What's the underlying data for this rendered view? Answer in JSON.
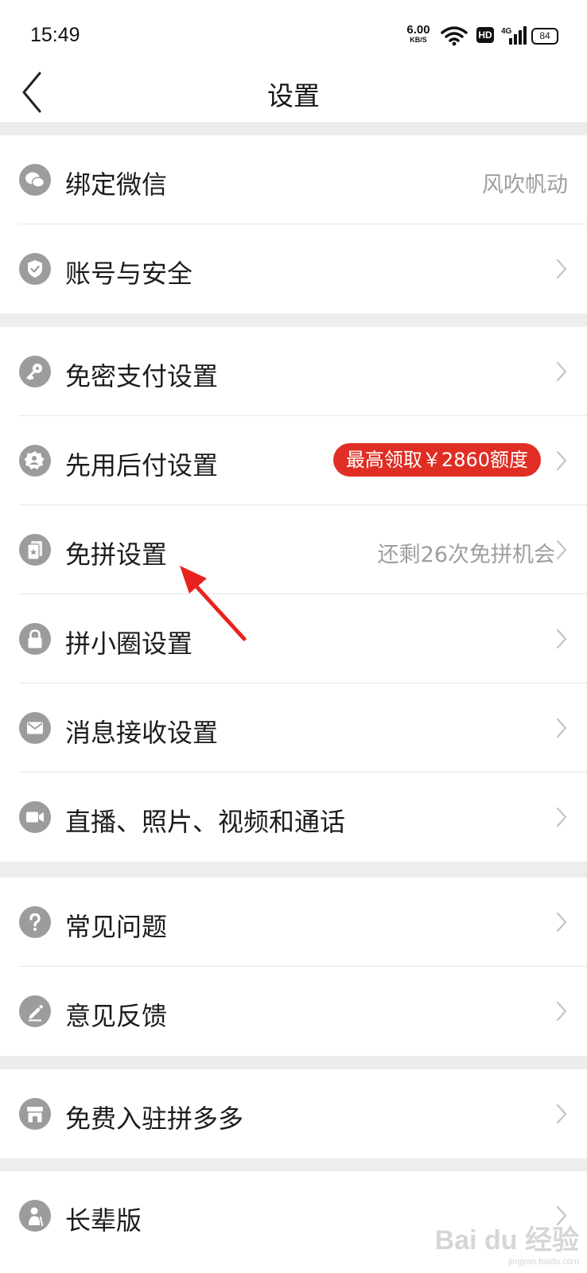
{
  "status_bar": {
    "time": "15:49",
    "net_speed_value": "6.00",
    "net_speed_unit": "KB/S",
    "hd_label": "HD",
    "network_type": "4G",
    "battery": "84"
  },
  "header": {
    "title": "设置"
  },
  "groups": [
    {
      "items": [
        {
          "label": "绑定微信",
          "value": "风吹帆动",
          "icon": "wechat-icon"
        },
        {
          "label": "账号与安全",
          "icon": "shield-icon"
        }
      ]
    },
    {
      "items": [
        {
          "label": "免密支付设置",
          "icon": "key-icon"
        },
        {
          "label": "先用后付设置",
          "badge": "最高领取￥2860额度",
          "icon": "badge-icon"
        },
        {
          "label": "免拼设置",
          "value": "还剩26次免拼机会",
          "icon": "cards-icon"
        },
        {
          "label": "拼小圈设置",
          "icon": "lock-icon"
        },
        {
          "label": "消息接收设置",
          "icon": "mail-icon"
        },
        {
          "label": "直播、照片、视频和通话",
          "icon": "video-icon"
        }
      ]
    },
    {
      "items": [
        {
          "label": "常见问题",
          "icon": "question-icon"
        },
        {
          "label": "意见反馈",
          "icon": "pencil-icon"
        }
      ]
    },
    {
      "items": [
        {
          "label": "免费入驻拼多多",
          "icon": "store-icon"
        }
      ]
    },
    {
      "items": [
        {
          "label": "长辈版",
          "icon": "elder-icon"
        }
      ]
    }
  ],
  "watermark": {
    "text": "Bai du 经验",
    "sub": "jingyan.baidu.com"
  },
  "colors": {
    "accent_red": "#e02e24",
    "icon_gray": "#9c9c9c",
    "annotation_arrow": "#e8231f"
  }
}
